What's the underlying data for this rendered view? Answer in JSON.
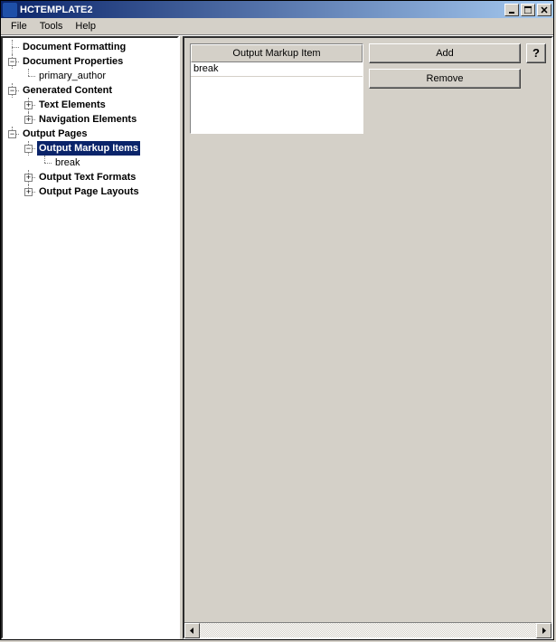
{
  "window": {
    "title": "HCTEMPLATE2"
  },
  "menubar": {
    "file": "File",
    "tools": "Tools",
    "help": "Help"
  },
  "tree": {
    "doc_formatting": "Document Formatting",
    "doc_properties": "Document Properties",
    "primary_author": "primary_author",
    "generated_content": "Generated Content",
    "text_elements": "Text Elements",
    "navigation_elements": "Navigation Elements",
    "output_pages": "Output Pages",
    "output_markup_items": "Output Markup Items",
    "break": "break",
    "output_text_formats": "Output Text Formats",
    "output_page_layouts": "Output Page Layouts"
  },
  "content": {
    "list_header": "Output Markup Item",
    "list_rows": [
      "break"
    ],
    "add_btn": "Add",
    "remove_btn": "Remove",
    "help_btn": "?"
  },
  "tree_expanders": {
    "minus": "−",
    "plus": "+"
  }
}
